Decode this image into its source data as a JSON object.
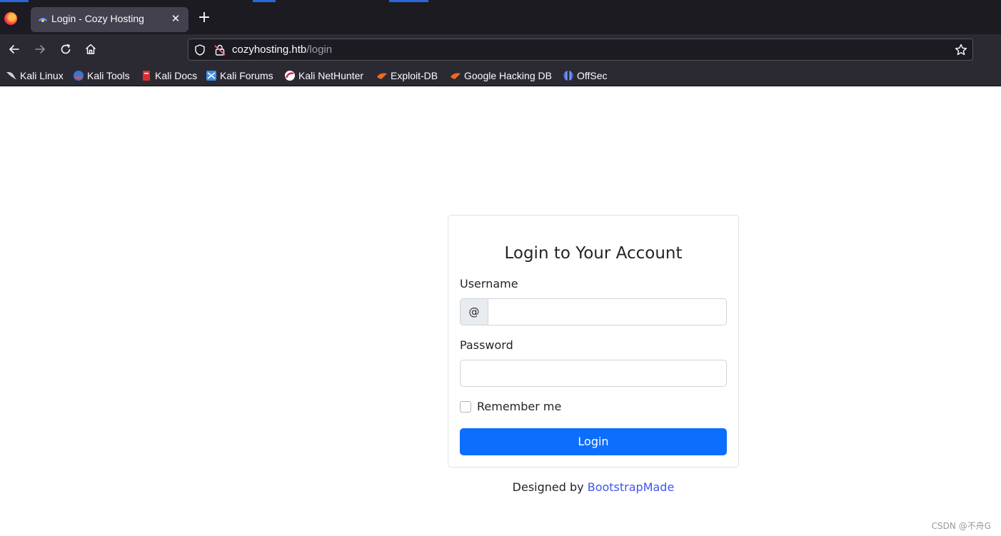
{
  "browser": {
    "tab_title": "Login - Cozy Hosting",
    "url_host": "cozyhosting.htb",
    "url_path": "/login"
  },
  "bookmarks": [
    {
      "label": "Kali Linux",
      "icon": "kali-dragon-icon"
    },
    {
      "label": "Kali Tools",
      "icon": "kali-tools-icon"
    },
    {
      "label": "Kali Docs",
      "icon": "kali-docs-icon"
    },
    {
      "label": "Kali Forums",
      "icon": "kali-forums-icon"
    },
    {
      "label": "Kali NetHunter",
      "icon": "kali-nethunter-icon"
    },
    {
      "label": "Exploit-DB",
      "icon": "exploit-db-icon"
    },
    {
      "label": "Google Hacking DB",
      "icon": "ghdb-icon"
    },
    {
      "label": "OffSec",
      "icon": "offsec-icon"
    }
  ],
  "login": {
    "title": "Login to Your Account",
    "username_label": "Username",
    "username_prefix": "@",
    "username_value": "",
    "password_label": "Password",
    "password_value": "",
    "remember_label": "Remember me",
    "submit_label": "Login"
  },
  "credits": {
    "prefix": "Designed by ",
    "link_text": "BootstrapMade"
  },
  "watermark": "CSDN @不舟G",
  "colors": {
    "primary": "#0d6efd",
    "link": "#4154f1",
    "chrome_dark": "#1c1b22",
    "chrome_mid": "#2b2a33"
  }
}
